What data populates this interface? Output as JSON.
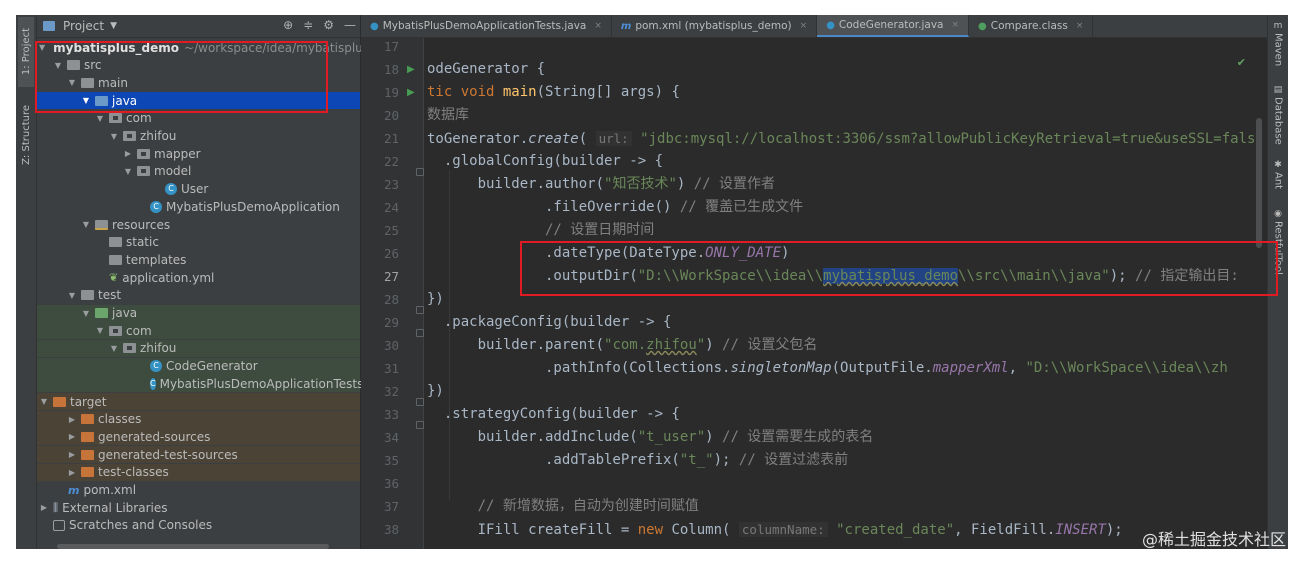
{
  "left_strip": {
    "project_tab": "1: Project",
    "structure_tab": "Z: Structure"
  },
  "project_panel": {
    "title": "Project",
    "tree": [
      {
        "label": "mybatisplus_demo",
        "path": "~/workspace/idea/mybatisplus_d"
      },
      {
        "label": "src"
      },
      {
        "label": "main"
      },
      {
        "label": "java"
      },
      {
        "label": "com"
      },
      {
        "label": "zhifou"
      },
      {
        "label": "mapper"
      },
      {
        "label": "model"
      },
      {
        "label": "User"
      },
      {
        "label": "MybatisPlusDemoApplication"
      },
      {
        "label": "resources"
      },
      {
        "label": "static"
      },
      {
        "label": "templates"
      },
      {
        "label": "application.yml"
      },
      {
        "label": "test"
      },
      {
        "label": "java"
      },
      {
        "label": "com"
      },
      {
        "label": "zhifou"
      },
      {
        "label": "CodeGenerator"
      },
      {
        "label": "MybatisPlusDemoApplicationTests"
      },
      {
        "label": "target"
      },
      {
        "label": "classes"
      },
      {
        "label": "generated-sources"
      },
      {
        "label": "generated-test-sources"
      },
      {
        "label": "test-classes"
      },
      {
        "label": "pom.xml"
      },
      {
        "label": "External Libraries"
      },
      {
        "label": "Scratches and Consoles"
      }
    ]
  },
  "tabs": [
    {
      "label": "MybatisPlusDemoApplicationTests.java"
    },
    {
      "label": "pom.xml (mybatisplus_demo)"
    },
    {
      "label": "CodeGenerator.java"
    },
    {
      "label": "Compare.class"
    }
  ],
  "editor": {
    "line_numbers": [
      "17",
      "18",
      "19",
      "20",
      "21",
      "22",
      "23",
      "24",
      "25",
      "26",
      "27",
      "28",
      "29",
      "30",
      "31",
      "32",
      "33",
      "34",
      "35",
      "36",
      "37",
      "38"
    ],
    "lines": {
      "l18": "odeGenerator {",
      "l19_a": "tic ",
      "l19_b": "void ",
      "l19_c": "main",
      "l19_d": "(String[] args) {",
      "l20": "数据库",
      "l21_a": "toGenerator.",
      "l21_b": "create",
      "l21_c": "(",
      "l21_hint": "url:",
      "l21_str": "\"jdbc:mysql://localhost:3306/ssm?allowPublicKeyRetrieval=true&useSSL=fals",
      "l22": "  .globalConfig(builder -> {",
      "l23_a": "      builder.author(",
      "l23_str": "\"知否技术\"",
      "l23_b": ") ",
      "l23_cmt": "// 设置作者",
      "l24_a": "              .fileOverride() ",
      "l24_cmt": "// 覆盖已生成文件",
      "l25_cmt": "              // 设置日期时间",
      "l26_a": "              .dateType(DateType.",
      "l26_const": "ONLY_DATE",
      "l26_b": ")",
      "l27_a": "              .outputDir(",
      "l27_s1": "\"D:\\\\WorkSpace\\\\idea\\\\",
      "l27_s2": "mybatisplus_demo",
      "l27_s3": "\\\\src\\\\main\\\\java\"",
      "l27_b": "); ",
      "l27_cmt": "// 指定输出目:",
      "l28": "})",
      "l29": "  .packageConfig(builder -> {",
      "l30_a": "      builder.parent(",
      "l30_str1": "\"com.",
      "l30_str2": "zhifou",
      "l30_str3": "\"",
      "l30_b": ") ",
      "l30_cmt": "// 设置父包名",
      "l31_a": "              .pathInfo(Collections.",
      "l31_it": "singletonMap",
      "l31_b": "(OutputFile.",
      "l31_const": "mapperXml",
      "l31_c": ", ",
      "l31_str": "\"D:\\\\WorkSpace\\\\idea\\\\zh",
      "l32": "})",
      "l33": "  .strategyConfig(builder -> {",
      "l34_a": "      builder.addInclude(",
      "l34_str": "\"t_user\"",
      "l34_b": ") ",
      "l34_cmt": "// 设置需要生成的表名",
      "l35_a": "              .addTablePrefix(",
      "l35_str": "\"t_\"",
      "l35_b": "); ",
      "l35_cmt": "// 设置过滤表前",
      "l37_cmt": "      // 新增数据，自动为创建时间赋值",
      "l38_a": "      IFill createFill = ",
      "l38_kw": "new ",
      "l38_b": "Column(",
      "l38_hint": "columnName:",
      "l38_str": "\"created_date\"",
      "l38_c": ", FieldFill.",
      "l38_const": "INSERT",
      "l38_d": ");"
    }
  },
  "right_strip": {
    "maven": "Maven",
    "database": "Database",
    "ant": "Ant",
    "restful": "RestfulTool"
  },
  "watermark": "@稀土掘金技术社区",
  "colors": {
    "highlight_box": "#e01b24",
    "selection": "#0d47b5"
  }
}
